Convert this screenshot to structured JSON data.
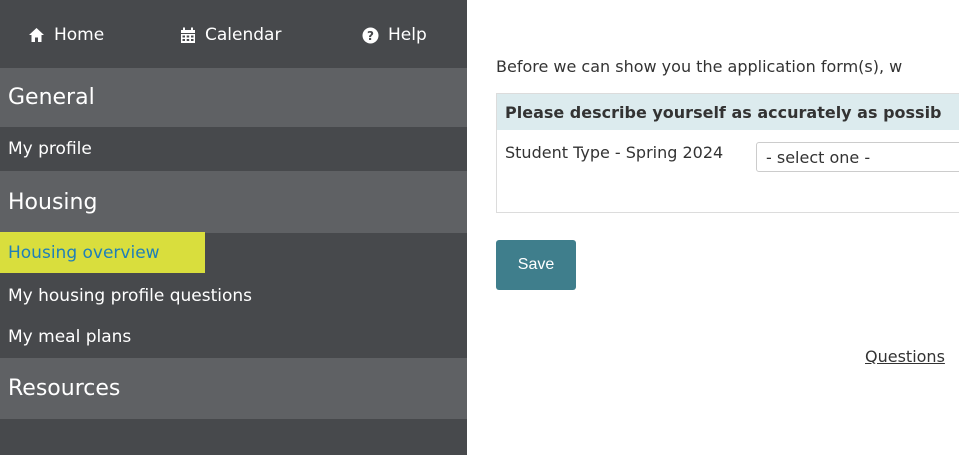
{
  "topnav": {
    "home_label": "Home",
    "calendar_label": "Calendar",
    "help_label": "Help"
  },
  "sidebar": {
    "general_header": "General",
    "my_profile": "My profile",
    "housing_header": "Housing",
    "housing_overview": "Housing overview",
    "housing_profile_questions": "My housing profile questions",
    "meal_plans": "My meal plans",
    "resources_header": "Resources"
  },
  "main": {
    "intro_text": "Before we can show you the application form(s), w",
    "table_header": "Please describe yourself as accurately as possib",
    "question_label": "Student Type - Spring 2024",
    "select_value": "- select one -",
    "save_label": "Save",
    "questions_link": "Questions"
  },
  "colors": {
    "sidebar_bg": "#47494c",
    "section_bg": "#5f6164",
    "highlight": "#e6ec3c",
    "save_button": "#3f7e8c",
    "table_header_bg": "#dcebee"
  },
  "icons": [
    "home-icon",
    "calendar-icon",
    "help-icon"
  ]
}
